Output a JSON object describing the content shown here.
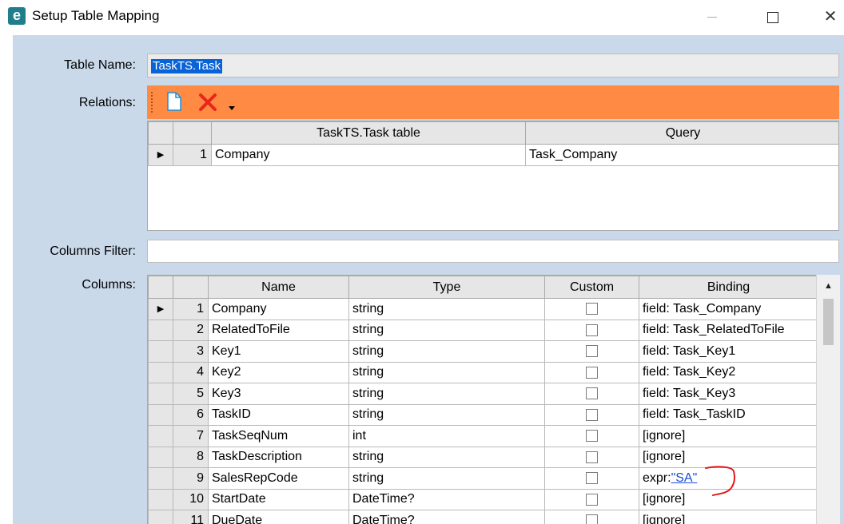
{
  "window": {
    "title": "Setup Table Mapping",
    "app_icon_glyph": "e",
    "controls": {
      "minimize": "minimize-icon",
      "maximize": "maximize-icon",
      "close": "close-icon"
    }
  },
  "form": {
    "table_name_label": "Table Name:",
    "table_name_value": "TaskTS.Task",
    "relations_label": "Relations:",
    "columns_filter_label": "Columns Filter:",
    "columns_filter_value": "",
    "columns_label": "Columns:"
  },
  "relations_toolbar": {
    "icons": [
      "new-document-icon",
      "delete-x-icon",
      "dropdown-arrow-icon"
    ],
    "delete_color": "#e8261c",
    "background_color": "#ff8a43"
  },
  "relations_grid": {
    "headers": [
      "TaskTS.Task table",
      "Query"
    ],
    "rows": [
      {
        "num": "1",
        "table": "Company",
        "query": "Task_Company"
      }
    ]
  },
  "columns_grid": {
    "headers": [
      "Name",
      "Type",
      "Custom",
      "Binding"
    ],
    "rows": [
      {
        "num": "1",
        "name": "Company",
        "type": "string",
        "binding": "field: Task_Company"
      },
      {
        "num": "2",
        "name": "RelatedToFile",
        "type": "string",
        "binding": "field: Task_RelatedToFile"
      },
      {
        "num": "3",
        "name": "Key1",
        "type": "string",
        "binding": "field: Task_Key1"
      },
      {
        "num": "4",
        "name": "Key2",
        "type": "string",
        "binding": "field: Task_Key2"
      },
      {
        "num": "5",
        "name": "Key3",
        "type": "string",
        "binding": "field: Task_Key3"
      },
      {
        "num": "6",
        "name": "TaskID",
        "type": "string",
        "binding": "field: Task_TaskID"
      },
      {
        "num": "7",
        "name": "TaskSeqNum",
        "type": "int",
        "binding": "[ignore]"
      },
      {
        "num": "8",
        "name": "TaskDescription",
        "type": "string",
        "binding": "[ignore]"
      },
      {
        "num": "9",
        "name": "SalesRepCode",
        "type": "string",
        "binding_prefix": "expr:",
        "binding_link": "\"SA\""
      },
      {
        "num": "10",
        "name": "StartDate",
        "type": "DateTime?",
        "binding": "[ignore]"
      },
      {
        "num": "11",
        "name": "DueDate",
        "type": "DateTime?",
        "binding": "[ignore]"
      }
    ]
  },
  "annotation": {
    "color": "#e01b1b"
  },
  "current_row_marker": "current-row-arrow-icon",
  "scrollbar": {
    "up": "scroll-up-arrow-icon"
  }
}
